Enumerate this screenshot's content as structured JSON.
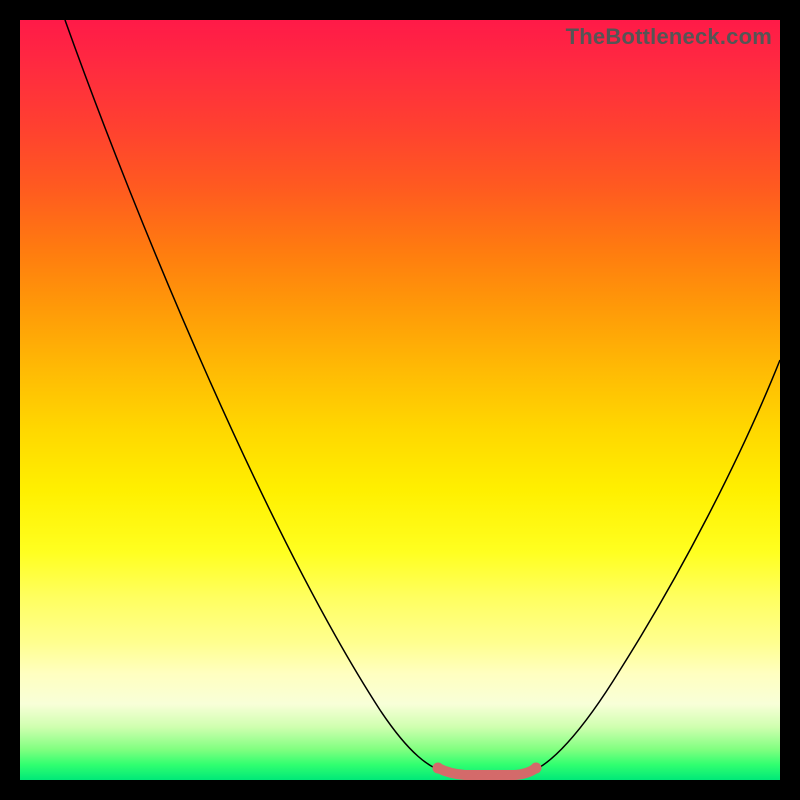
{
  "watermark": "TheBottleneck.com",
  "chart_data": {
    "type": "line",
    "title": "",
    "xlabel": "",
    "ylabel": "",
    "xlim": [
      0,
      100
    ],
    "ylim": [
      0,
      100
    ],
    "grid": false,
    "legend": false,
    "annotations": [],
    "series": [
      {
        "name": "left-curve",
        "x": [
          6,
          12,
          18,
          24,
          30,
          36,
          42,
          48,
          53,
          57
        ],
        "values": [
          100,
          84,
          68,
          53,
          39,
          26,
          15,
          7,
          2,
          0
        ]
      },
      {
        "name": "right-curve",
        "x": [
          66,
          70,
          75,
          80,
          85,
          90,
          95,
          100
        ],
        "values": [
          0,
          2,
          7,
          14,
          23,
          33,
          44,
          56
        ]
      }
    ],
    "highlight_range_x": [
      53,
      66
    ],
    "highlight_range_y_value": 0,
    "colors": {
      "gradient_top": "#ff1a48",
      "gradient_mid": "#ffee00",
      "gradient_bottom": "#00e878",
      "curve": "#000000",
      "highlight": "#d46a6a",
      "frame": "#000000"
    }
  }
}
